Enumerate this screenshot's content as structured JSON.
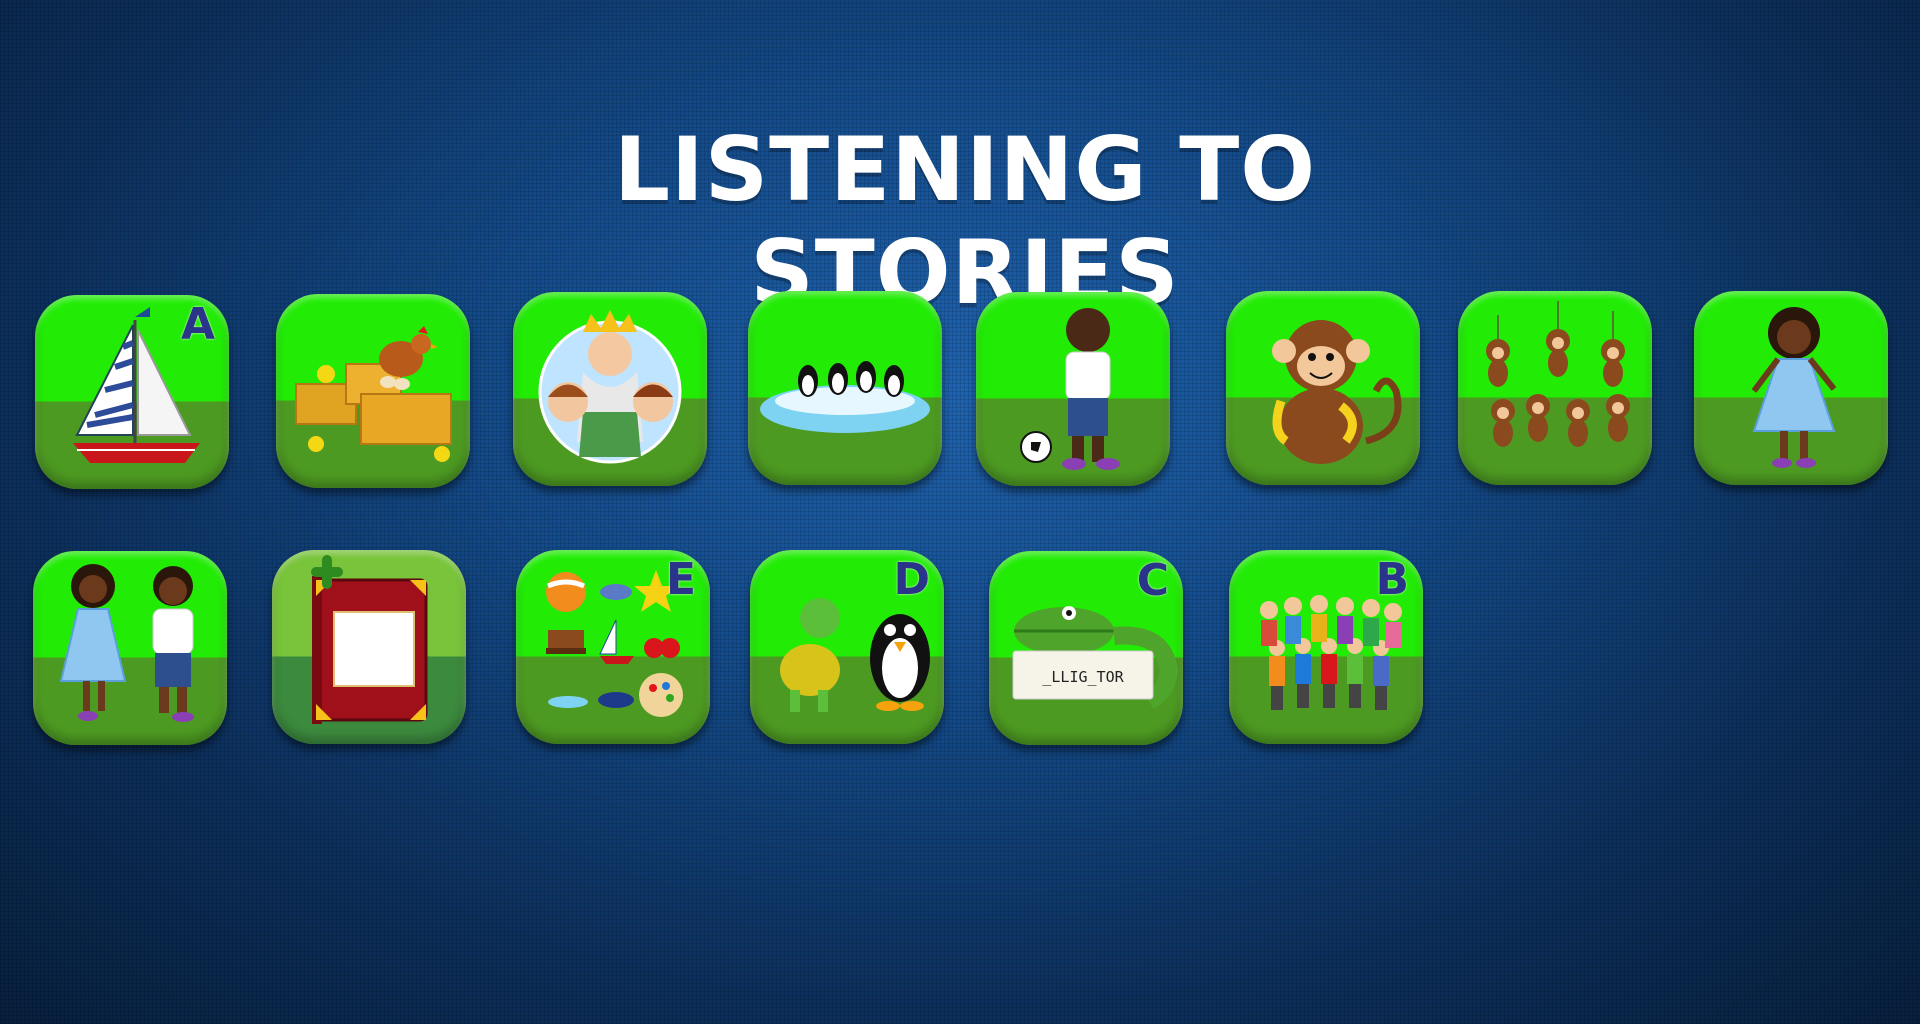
{
  "title": "LISTENING TO STORIES",
  "tiles_row1": [
    {
      "name": "tile-sailboat",
      "icon": "sailboat",
      "letter": "A"
    },
    {
      "name": "tile-hen-haystack",
      "icon": "hen-on-hay",
      "letter": ""
    },
    {
      "name": "tile-king-children",
      "icon": "king-and-children",
      "letter": ""
    },
    {
      "name": "tile-penguins-ice",
      "icon": "penguins-on-ice",
      "letter": ""
    },
    {
      "name": "tile-boy-ball",
      "icon": "boy-with-ball",
      "letter": ""
    },
    {
      "name": "tile-monkey-banana",
      "icon": "monkey-with-banana",
      "letter": ""
    },
    {
      "name": "tile-five-monkeys",
      "icon": "five-monkeys",
      "letter": ""
    },
    {
      "name": "tile-girl-dress",
      "icon": "girl-in-dress",
      "letter": ""
    }
  ],
  "tiles_row2": [
    {
      "name": "tile-girl-boy",
      "icon": "girl-and-boy",
      "letter": ""
    },
    {
      "name": "tile-add-book",
      "icon": "add-book",
      "letter": ""
    },
    {
      "name": "tile-e-objects",
      "icon": "objects-collection",
      "letter": "E"
    },
    {
      "name": "tile-turtle-penguin",
      "icon": "turtle-and-penguin",
      "letter": "D"
    },
    {
      "name": "tile-alligator-word",
      "icon": "alligator-sign",
      "letter": "C",
      "sign_text": "_LLIG_TOR"
    },
    {
      "name": "tile-family-crowd",
      "icon": "family-group",
      "letter": "B"
    }
  ],
  "colors": {
    "tile_top": "#22ec06",
    "tile_bottom": "#4d9a22",
    "letter": "#2a3488",
    "background": "#124a8a"
  }
}
